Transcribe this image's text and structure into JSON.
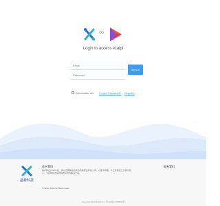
{
  "header": {
    "logo_icon": "xtalpi-x-icon",
    "link_symbol": "∞",
    "partner_icon": "play-logo-icon",
    "subtitle": "Login to access Xtalpi"
  },
  "login": {
    "email_placeholder": "Email",
    "password_placeholder": "Password",
    "signin_label": "Sign In",
    "remember_label": "Remember me",
    "forgot_label": "Forgot Password?",
    "register_label": "Register"
  },
  "footer": {
    "brand_name": "晶泰科技",
    "about_title": "关于我们",
    "about_text": "晶泰科技(XtalPi)是一家以计算驱动创新的药物研发科技公司，以量子物理、人工智能和云计算为核心，为药物研发提供精准高效的解决方案。",
    "slogan": "Smarter Science, Better Lives",
    "contact_title": "联系我们",
    "contact_text": "",
    "copyright": "Copyright 2018 XtalPi Inc. 粤ICP备17109653号"
  },
  "colors": {
    "accent": "#3e9bf5",
    "wave_light": "#eaf2fd",
    "wave_mid": "#d6e6fb",
    "footer_bg": "#f7f7f7"
  }
}
